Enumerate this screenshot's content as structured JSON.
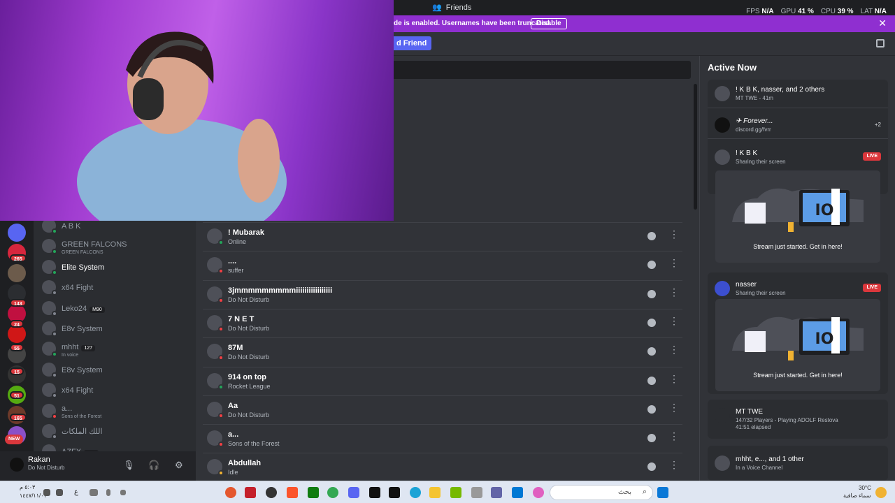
{
  "titlebar": {
    "title": "Friends",
    "fps_label": "FPS",
    "fps": "N/A",
    "gpu_label": "GPU",
    "gpu": "41 %",
    "cpu_label": "CPU",
    "cpu": "39 %",
    "lat_label": "LAT",
    "lat": "N/A"
  },
  "banner": {
    "text": "de is enabled. Usernames have been truncated.",
    "button": "Disable"
  },
  "header": {
    "add_friend": "d Friend"
  },
  "server_badges": [
    "265",
    "143",
    "24",
    "55",
    "15",
    "51",
    "165"
  ],
  "server_new": "NEW",
  "dm_list": [
    {
      "name": "A B K",
      "sub": ""
    },
    {
      "name": "GREEN FALCONS",
      "sub": "GREEN FALCONS"
    },
    {
      "name": "Elite System",
      "sub": ""
    },
    {
      "name": "x64 Fight",
      "sub": ""
    },
    {
      "name": "Leko24",
      "sub": "",
      "tag": "M90"
    },
    {
      "name": "E8v System",
      "sub": ""
    },
    {
      "name": "mhht",
      "sub": "In voice",
      "tag": "127"
    },
    {
      "name": "E8v System",
      "sub": ""
    },
    {
      "name": "x64 Fight",
      "sub": ""
    },
    {
      "name": "a...",
      "sub": "Sons of the Forest"
    },
    {
      "name": "اللك الملكات",
      "sub": ""
    },
    {
      "name": "AZFX",
      "sub": "",
      "tag": "شعر"
    }
  ],
  "user": {
    "name": "Rakan",
    "status": "Do Not Disturb"
  },
  "friends": [
    {
      "name": "! Mubarak",
      "status": "Online",
      "color": "#23a55a"
    },
    {
      "name": "....",
      "status": "suffer",
      "color": "#f23f43"
    },
    {
      "name": "3jmmmmmmmmmiiiiiiiiiiiiiiiii",
      "status": "Do Not Disturb",
      "color": "#f23f43"
    },
    {
      "name": "7 N E T",
      "status": "Do Not Disturb",
      "color": "#f23f43"
    },
    {
      "name": "87M",
      "status": "Do Not Disturb",
      "color": "#f23f43"
    },
    {
      "name": "914 on top",
      "status": "Rocket League",
      "color": "#23a55a"
    },
    {
      "name": "Aa",
      "status": "Do Not Disturb",
      "color": "#f23f43"
    },
    {
      "name": "a...",
      "status": "Sons of the Forest",
      "color": "#f23f43"
    },
    {
      "name": "Abdullah",
      "status": "Idle",
      "color": "#f0b232"
    }
  ],
  "active_now": {
    "heading": "Active Now",
    "card1": {
      "name": "! K B K, nasser, and 2 others",
      "status": "MT TWE - 41m"
    },
    "card2": {
      "name": "✈ Forever...",
      "status": "discord.gg/fvrr",
      "extra": "+2"
    },
    "card3": {
      "name": "! K B K",
      "status": "Sharing their screen",
      "live": "LIVE",
      "caption": "Stream just started. Get in here!",
      "screen_text": "IO"
    },
    "card4": {
      "name": "nasser",
      "status": "Sharing their screen",
      "live": "LIVE",
      "caption": "Stream just started. Get in here!",
      "screen_text": "IO"
    },
    "card5": {
      "name": "MT TWE",
      "status": "147/32 Players - Playing ADOLF Restova",
      "elapsed": "41:51 elapsed"
    },
    "card6": {
      "name": "mhht, e..., and 1 other",
      "status": "In a Voice Channel"
    }
  },
  "taskbar": {
    "search_text": "بحث",
    "temp": "30°C",
    "weather": "سماء صافية",
    "time": "٥:٠٣ م",
    "date": "١٤٤٧/١١/٠١",
    "lang": "ع"
  }
}
